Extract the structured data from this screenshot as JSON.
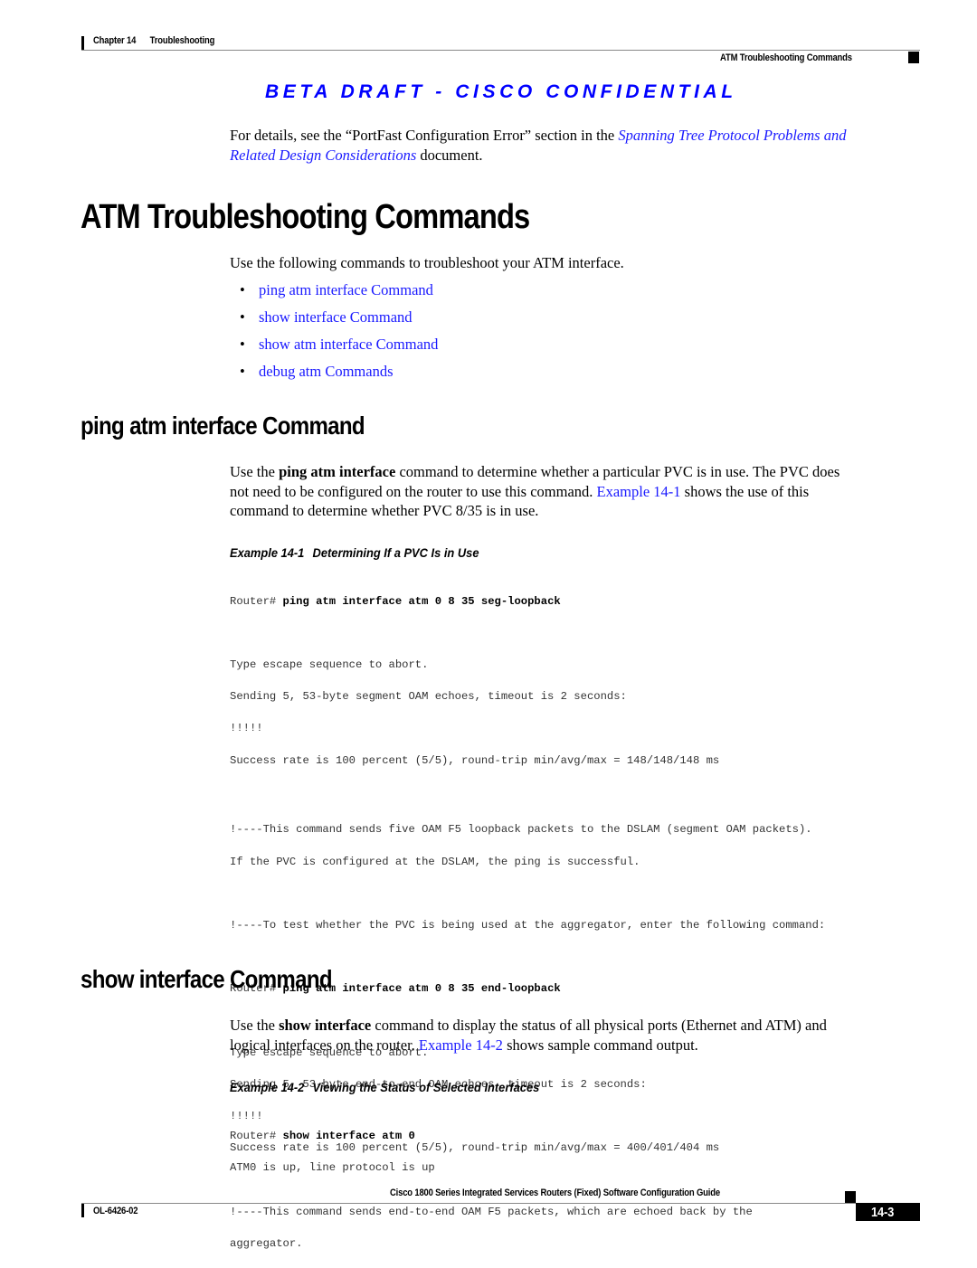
{
  "header": {
    "chapter_label": "Chapter 14",
    "chapter_title": "Troubleshooting",
    "section_title": "ATM Troubleshooting Commands",
    "watermark": "BETA DRAFT - CISCO CONFIDENTIAL"
  },
  "intro": {
    "text_before": "For details, see the “PortFast Configuration Error” section in the ",
    "link_line1": "Spanning Tree Protocol Problems and",
    "link_line2": "Related Design Considerations",
    "text_after": " document."
  },
  "main_heading": "ATM Troubleshooting Commands",
  "main_intro": "Use the following commands to troubleshoot your ATM interface.",
  "toc": [
    {
      "label": "ping atm interface Command"
    },
    {
      "label": "show interface Command"
    },
    {
      "label": "show atm interface Command"
    },
    {
      "label": "debug atm Commands"
    }
  ],
  "bullet_glyph": "•",
  "section_ping": {
    "heading": "ping atm interface Command",
    "para_start": "Use the ",
    "para_bold": "ping atm interface",
    "para_mid": " command to determine whether a particular PVC is in use. The PVC does",
    "para_line2_start": "not need to be configured on the router to use this command. ",
    "para_link": "Example 14-1",
    "para_line2_end": " shows the use of this",
    "para_line3": "command to determine whether PVC 8/35 is in use.",
    "example_caption_num": "Example 14-1",
    "example_caption_title": "Determining If a PVC Is in Use",
    "prompt": "Router# ",
    "cmd1": "ping atm interface atm 0 8 35 seg-loopback",
    "out1": [
      "Type escape sequence to abort.",
      "Sending 5, 53-byte segment OAM echoes, timeout is 2 seconds:",
      "!!!!!",
      "Success rate is 100 percent (5/5), round-trip min/avg/max = 148/148/148 ms"
    ],
    "comment1": [
      "!----This command sends five OAM F5 loopback packets to the DSLAM (segment OAM packets).",
      "If the PVC is configured at the DSLAM, the ping is successful."
    ],
    "comment2": "!----To test whether the PVC is being used at the aggregator, enter the following command:",
    "cmd2": "ping atm interface atm 0 8 35 end-loopback",
    "out2": [
      "Type escape sequence to abort.",
      "Sending 5, 53-byte end-to-end OAM echoes, timeout is 2 seconds:",
      "!!!!!",
      "Success rate is 100 percent (5/5), round-trip min/avg/max = 400/401/404 ms"
    ],
    "comment3": [
      "!----This command sends end-to-end OAM F5 packets, which are echoed back by the",
      "aggregator."
    ]
  },
  "section_show": {
    "heading": "show interface Command",
    "para_start": "Use the ",
    "para_bold": "show interface",
    "para_mid": " command to display the status of all physical ports (Ethernet and ATM) and",
    "para_line2_start": "logical interfaces on the router. ",
    "para_link": "Example 14-2",
    "para_line2_end": " shows sample command output.",
    "example_caption_num": "Example 14-2",
    "example_caption_title": "Viewing the Status of Selected Interfaces",
    "prompt": "Router# ",
    "cmd": "show interface atm 0",
    "out": [
      "ATM0 is up, line protocol is up"
    ]
  },
  "footer": {
    "guide_title": "Cisco 1800 Series Integrated Services Routers (Fixed) Software Configuration Guide",
    "doc_number": "OL-6426-02",
    "page_number": "14-3"
  },
  "colors": {
    "link": "#1a1aff",
    "watermark": "#0000ff",
    "rule": "#888888"
  }
}
